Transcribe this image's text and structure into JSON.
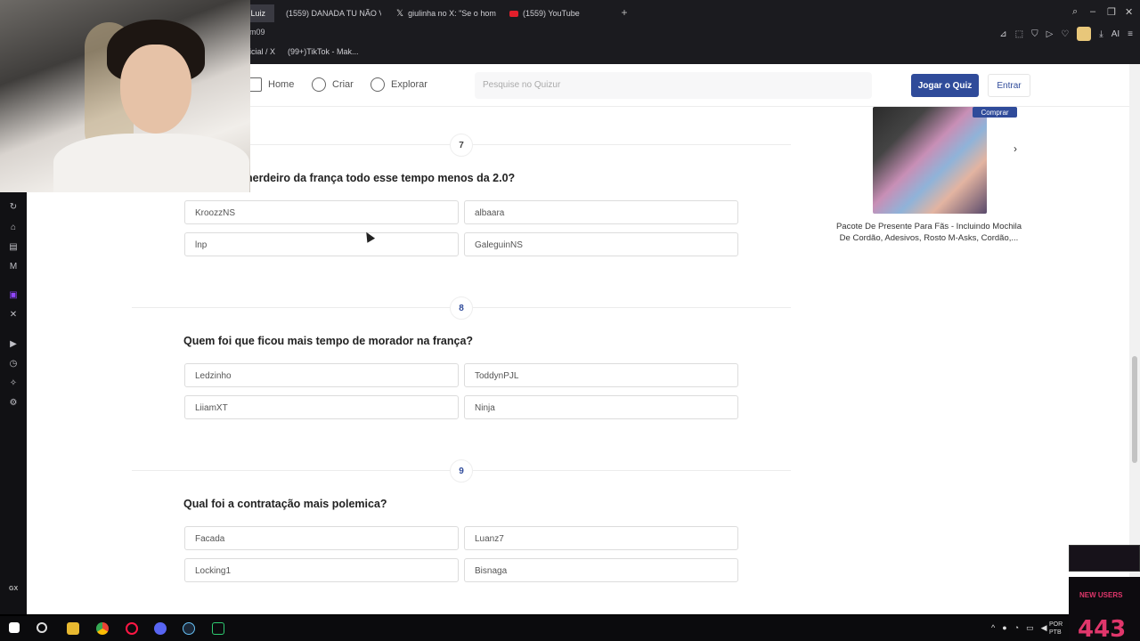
{
  "browser": {
    "tabs": [
      {
        "label": "Luiz"
      },
      {
        "label": "(1559) DANADA TU NÃO V"
      },
      {
        "label": "giulinha no X: \"Se o homi"
      },
      {
        "label": "(1559) YouTube"
      }
    ],
    "address_fragment": "m09",
    "bookmarks": [
      {
        "label": "icial / X"
      },
      {
        "label": "(99+)TikTok - Mak..."
      }
    ]
  },
  "site": {
    "nav": [
      {
        "label": "Home",
        "icon": "home-icon"
      },
      {
        "label": "Criar",
        "icon": "plus-icon"
      },
      {
        "label": "Explorar",
        "icon": "compass-icon"
      }
    ],
    "search_placeholder": "Pesquise no Quizur",
    "play_button": "Jogar o Quiz",
    "login_button": "Entrar"
  },
  "questions": [
    {
      "number": "7",
      "title": "herdeiro da frança todo esse tempo menos da 2.0?",
      "options": [
        "KroozzNS",
        "albaara",
        "lnp",
        "GaleguinNS"
      ]
    },
    {
      "number": "8",
      "title": "Quem foi que ficou mais tempo de morador na frança?",
      "options": [
        "Ledzinho",
        "ToddynPJL",
        "LiiamXT",
        "Ninja"
      ]
    },
    {
      "number": "9",
      "title": "Qual foi a contratação mais polemica?",
      "options": [
        "Facada",
        "Luanz7",
        "Locking1",
        "Bisnaga"
      ]
    }
  ],
  "ad": {
    "badge": "Comprar",
    "text": "Pacote De Presente Para Fãs - Incluindo Mochila De Cordão, Adesivos, Rosto M-Asks, Cordão,..."
  },
  "taskbar": {
    "lang_top": "POR",
    "lang_bottom": "PTB"
  },
  "stream_overlay": {
    "label": "NEW USERS",
    "count": "443"
  }
}
